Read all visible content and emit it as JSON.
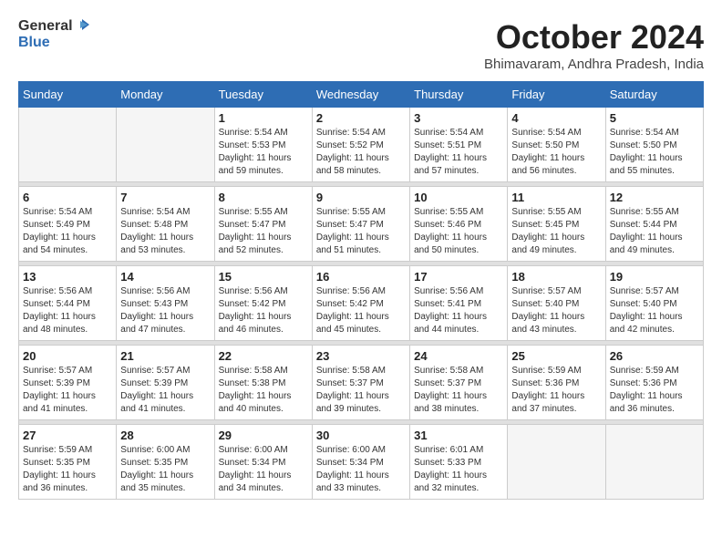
{
  "logo": {
    "general": "General",
    "blue": "Blue"
  },
  "title": "October 2024",
  "location": "Bhimavaram, Andhra Pradesh, India",
  "days_header": [
    "Sunday",
    "Monday",
    "Tuesday",
    "Wednesday",
    "Thursday",
    "Friday",
    "Saturday"
  ],
  "weeks": [
    [
      {
        "day": "",
        "info": ""
      },
      {
        "day": "",
        "info": ""
      },
      {
        "day": "1",
        "sunrise": "Sunrise: 5:54 AM",
        "sunset": "Sunset: 5:53 PM",
        "daylight": "Daylight: 11 hours and 59 minutes."
      },
      {
        "day": "2",
        "sunrise": "Sunrise: 5:54 AM",
        "sunset": "Sunset: 5:52 PM",
        "daylight": "Daylight: 11 hours and 58 minutes."
      },
      {
        "day": "3",
        "sunrise": "Sunrise: 5:54 AM",
        "sunset": "Sunset: 5:51 PM",
        "daylight": "Daylight: 11 hours and 57 minutes."
      },
      {
        "day": "4",
        "sunrise": "Sunrise: 5:54 AM",
        "sunset": "Sunset: 5:50 PM",
        "daylight": "Daylight: 11 hours and 56 minutes."
      },
      {
        "day": "5",
        "sunrise": "Sunrise: 5:54 AM",
        "sunset": "Sunset: 5:50 PM",
        "daylight": "Daylight: 11 hours and 55 minutes."
      }
    ],
    [
      {
        "day": "6",
        "sunrise": "Sunrise: 5:54 AM",
        "sunset": "Sunset: 5:49 PM",
        "daylight": "Daylight: 11 hours and 54 minutes."
      },
      {
        "day": "7",
        "sunrise": "Sunrise: 5:54 AM",
        "sunset": "Sunset: 5:48 PM",
        "daylight": "Daylight: 11 hours and 53 minutes."
      },
      {
        "day": "8",
        "sunrise": "Sunrise: 5:55 AM",
        "sunset": "Sunset: 5:47 PM",
        "daylight": "Daylight: 11 hours and 52 minutes."
      },
      {
        "day": "9",
        "sunrise": "Sunrise: 5:55 AM",
        "sunset": "Sunset: 5:47 PM",
        "daylight": "Daylight: 11 hours and 51 minutes."
      },
      {
        "day": "10",
        "sunrise": "Sunrise: 5:55 AM",
        "sunset": "Sunset: 5:46 PM",
        "daylight": "Daylight: 11 hours and 50 minutes."
      },
      {
        "day": "11",
        "sunrise": "Sunrise: 5:55 AM",
        "sunset": "Sunset: 5:45 PM",
        "daylight": "Daylight: 11 hours and 49 minutes."
      },
      {
        "day": "12",
        "sunrise": "Sunrise: 5:55 AM",
        "sunset": "Sunset: 5:44 PM",
        "daylight": "Daylight: 11 hours and 49 minutes."
      }
    ],
    [
      {
        "day": "13",
        "sunrise": "Sunrise: 5:56 AM",
        "sunset": "Sunset: 5:44 PM",
        "daylight": "Daylight: 11 hours and 48 minutes."
      },
      {
        "day": "14",
        "sunrise": "Sunrise: 5:56 AM",
        "sunset": "Sunset: 5:43 PM",
        "daylight": "Daylight: 11 hours and 47 minutes."
      },
      {
        "day": "15",
        "sunrise": "Sunrise: 5:56 AM",
        "sunset": "Sunset: 5:42 PM",
        "daylight": "Daylight: 11 hours and 46 minutes."
      },
      {
        "day": "16",
        "sunrise": "Sunrise: 5:56 AM",
        "sunset": "Sunset: 5:42 PM",
        "daylight": "Daylight: 11 hours and 45 minutes."
      },
      {
        "day": "17",
        "sunrise": "Sunrise: 5:56 AM",
        "sunset": "Sunset: 5:41 PM",
        "daylight": "Daylight: 11 hours and 44 minutes."
      },
      {
        "day": "18",
        "sunrise": "Sunrise: 5:57 AM",
        "sunset": "Sunset: 5:40 PM",
        "daylight": "Daylight: 11 hours and 43 minutes."
      },
      {
        "day": "19",
        "sunrise": "Sunrise: 5:57 AM",
        "sunset": "Sunset: 5:40 PM",
        "daylight": "Daylight: 11 hours and 42 minutes."
      }
    ],
    [
      {
        "day": "20",
        "sunrise": "Sunrise: 5:57 AM",
        "sunset": "Sunset: 5:39 PM",
        "daylight": "Daylight: 11 hours and 41 minutes."
      },
      {
        "day": "21",
        "sunrise": "Sunrise: 5:57 AM",
        "sunset": "Sunset: 5:39 PM",
        "daylight": "Daylight: 11 hours and 41 minutes."
      },
      {
        "day": "22",
        "sunrise": "Sunrise: 5:58 AM",
        "sunset": "Sunset: 5:38 PM",
        "daylight": "Daylight: 11 hours and 40 minutes."
      },
      {
        "day": "23",
        "sunrise": "Sunrise: 5:58 AM",
        "sunset": "Sunset: 5:37 PM",
        "daylight": "Daylight: 11 hours and 39 minutes."
      },
      {
        "day": "24",
        "sunrise": "Sunrise: 5:58 AM",
        "sunset": "Sunset: 5:37 PM",
        "daylight": "Daylight: 11 hours and 38 minutes."
      },
      {
        "day": "25",
        "sunrise": "Sunrise: 5:59 AM",
        "sunset": "Sunset: 5:36 PM",
        "daylight": "Daylight: 11 hours and 37 minutes."
      },
      {
        "day": "26",
        "sunrise": "Sunrise: 5:59 AM",
        "sunset": "Sunset: 5:36 PM",
        "daylight": "Daylight: 11 hours and 36 minutes."
      }
    ],
    [
      {
        "day": "27",
        "sunrise": "Sunrise: 5:59 AM",
        "sunset": "Sunset: 5:35 PM",
        "daylight": "Daylight: 11 hours and 36 minutes."
      },
      {
        "day": "28",
        "sunrise": "Sunrise: 6:00 AM",
        "sunset": "Sunset: 5:35 PM",
        "daylight": "Daylight: 11 hours and 35 minutes."
      },
      {
        "day": "29",
        "sunrise": "Sunrise: 6:00 AM",
        "sunset": "Sunset: 5:34 PM",
        "daylight": "Daylight: 11 hours and 34 minutes."
      },
      {
        "day": "30",
        "sunrise": "Sunrise: 6:00 AM",
        "sunset": "Sunset: 5:34 PM",
        "daylight": "Daylight: 11 hours and 33 minutes."
      },
      {
        "day": "31",
        "sunrise": "Sunrise: 6:01 AM",
        "sunset": "Sunset: 5:33 PM",
        "daylight": "Daylight: 11 hours and 32 minutes."
      },
      {
        "day": "",
        "info": ""
      },
      {
        "day": "",
        "info": ""
      }
    ]
  ]
}
